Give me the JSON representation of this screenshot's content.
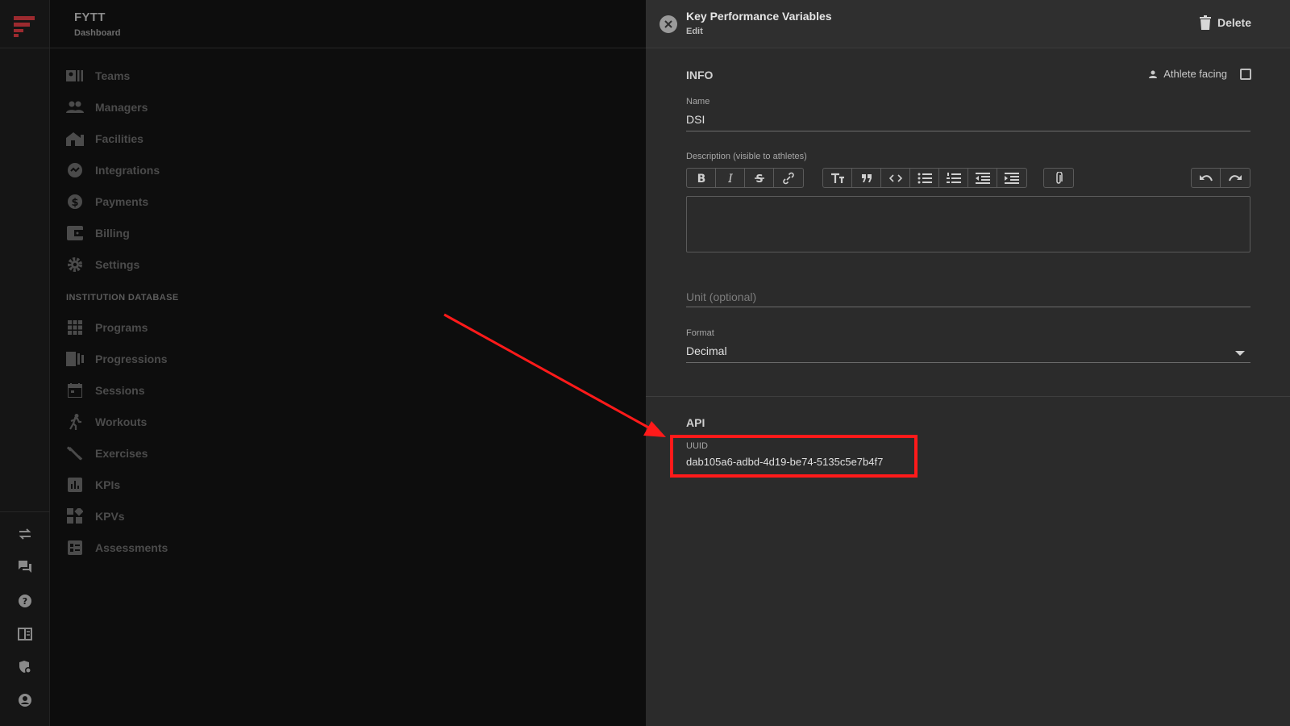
{
  "app": {
    "title": "FYTT",
    "subtitle": "Dashboard"
  },
  "nav": {
    "items": [
      {
        "label": "Teams",
        "icon": "teams-icon"
      },
      {
        "label": "Managers",
        "icon": "managers-icon"
      },
      {
        "label": "Facilities",
        "icon": "facilities-icon"
      },
      {
        "label": "Integrations",
        "icon": "integrations-icon"
      },
      {
        "label": "Payments",
        "icon": "payments-icon"
      },
      {
        "label": "Billing",
        "icon": "billing-icon"
      },
      {
        "label": "Settings",
        "icon": "settings-icon"
      }
    ],
    "section_title": "INSTITUTION DATABASE",
    "db_items": [
      {
        "label": "Programs",
        "icon": "programs-icon"
      },
      {
        "label": "Progressions",
        "icon": "progressions-icon"
      },
      {
        "label": "Sessions",
        "icon": "sessions-icon"
      },
      {
        "label": "Workouts",
        "icon": "workouts-icon"
      },
      {
        "label": "Exercises",
        "icon": "exercises-icon"
      },
      {
        "label": "KPIs",
        "icon": "kpis-icon"
      },
      {
        "label": "KPVs",
        "icon": "kpvs-icon"
      },
      {
        "label": "Assessments",
        "icon": "assessments-icon"
      }
    ]
  },
  "rail": {
    "icons": [
      "swap-icon",
      "chat-icon",
      "help-icon",
      "ledger-icon",
      "shield-icon",
      "account-icon"
    ]
  },
  "panel": {
    "title": "Key Performance Variables",
    "subtitle": "Edit",
    "delete_label": "Delete",
    "info": {
      "section_title": "INFO",
      "athlete_facing_label": "Athlete facing",
      "athlete_facing_checked": false,
      "name_label": "Name",
      "name_value": "DSI",
      "description_label": "Description (visible to athletes)",
      "unit_placeholder": "Unit (optional)",
      "format_label": "Format",
      "format_value": "Decimal"
    },
    "api": {
      "section_title": "API",
      "uuid_label": "UUID",
      "uuid_value": "dab105a6-adbd-4d19-be74-5135c5e7b4f7"
    }
  },
  "colors": {
    "brand": "#b3242c",
    "highlight": "#ff1a1a",
    "panel_bg": "#2b2b2b"
  }
}
